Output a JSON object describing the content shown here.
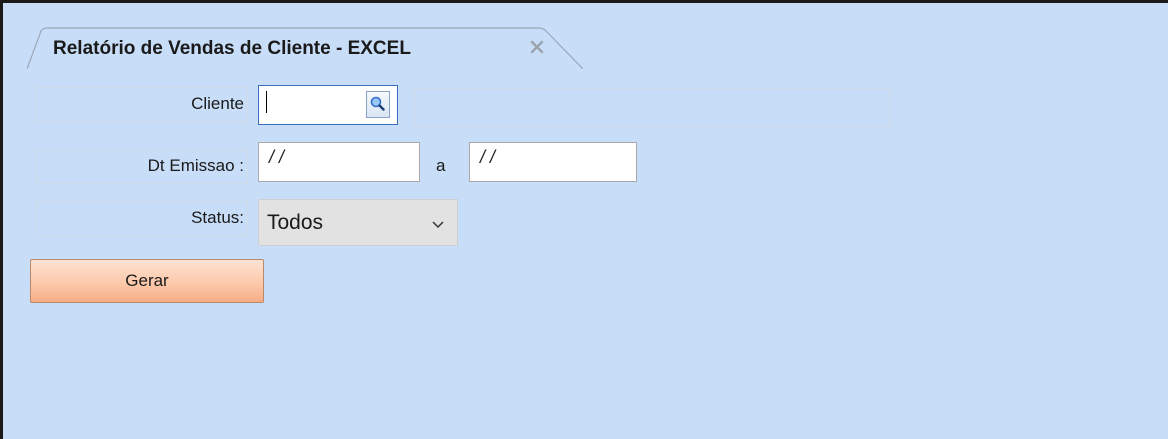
{
  "tab": {
    "title": "Relatório de Vendas de Cliente - EXCEL",
    "close_icon": "close-icon"
  },
  "form": {
    "cliente": {
      "label": "Cliente",
      "value": "",
      "lookup_icon": "magnifier-icon"
    },
    "dt_emissao": {
      "label": "Dt Emissao :",
      "from_value": "/ /",
      "separator": "a",
      "to_value": "/ /"
    },
    "status": {
      "label": "Status:",
      "selected": "Todos",
      "chevron_icon": "chevron-down-icon"
    }
  },
  "actions": {
    "gerar_label": "Gerar"
  },
  "colors": {
    "panel_background": "#c8ddf7",
    "button_gradient_top": "#fde3d3",
    "button_gradient_bottom": "#f7ad86",
    "lookup_lens": "#2f6fd0"
  }
}
